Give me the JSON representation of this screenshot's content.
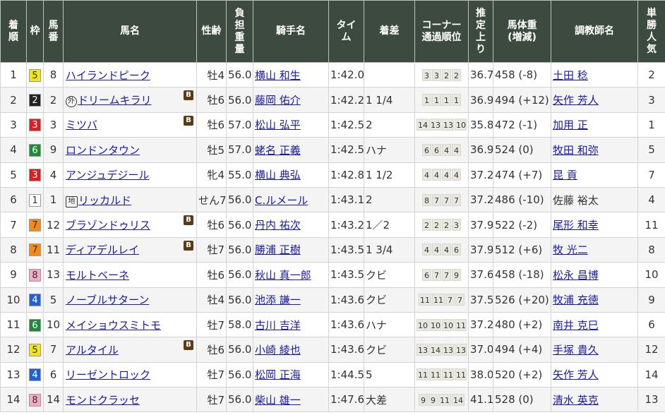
{
  "headers": {
    "rank": [
      "着",
      "順"
    ],
    "waku": "枠",
    "umaban": [
      "馬",
      "番"
    ],
    "horse": "馬名",
    "sexage": "性齢",
    "weight": [
      "負",
      "担",
      "重",
      "量"
    ],
    "jockey": "騎手名",
    "time": [
      "タイ",
      "ム"
    ],
    "margin": "着差",
    "corner": [
      "コーナー",
      "通過順位"
    ],
    "last3f": [
      "推",
      "定",
      "上",
      "り"
    ],
    "bodyweight": [
      "馬体重",
      "(増減)"
    ],
    "trainer": "調教師名",
    "pop": [
      "単",
      "勝",
      "人",
      "気"
    ]
  },
  "waku_colors": {
    "1": {
      "bg": "#ffffff",
      "fg": "#333333"
    },
    "2": {
      "bg": "#222222",
      "fg": "#ffffff"
    },
    "3": {
      "bg": "#d91f1f",
      "fg": "#ffffff"
    },
    "4": {
      "bg": "#1e62d0",
      "fg": "#ffffff"
    },
    "5": {
      "bg": "#f3e514",
      "fg": "#333333"
    },
    "6": {
      "bg": "#1f8a3a",
      "fg": "#ffffff"
    },
    "7": {
      "bg": "#f58a14",
      "fg": "#333333"
    },
    "8": {
      "bg": "#f7a8c4",
      "fg": "#333333"
    }
  },
  "rows": [
    {
      "rank": "1",
      "waku": "5",
      "umaban": "8",
      "mark": "",
      "horse": "ハイランドピーク",
      "blinker": false,
      "sexage": "牡4",
      "weight": "56.0",
      "jockey": "横山 和生",
      "time": "1:42.0",
      "margin": "",
      "corner": [
        "3",
        "3",
        "2",
        "2"
      ],
      "last3f": "36.7",
      "bodyweight": "458 (-8)",
      "trainer": "土田 稔",
      "trainer_link": true,
      "pop": "2"
    },
    {
      "rank": "2",
      "waku": "2",
      "umaban": "2",
      "mark": "外",
      "horse": "ドリームキラリ",
      "blinker": true,
      "sexage": "牡6",
      "weight": "56.0",
      "jockey": "藤岡 佑介",
      "time": "1:42.2",
      "margin": "1 1/4",
      "corner": [
        "1",
        "1",
        "1",
        "1"
      ],
      "last3f": "36.9",
      "bodyweight": "494 (+12)",
      "trainer": "矢作 芳人",
      "trainer_link": true,
      "pop": "3"
    },
    {
      "rank": "3",
      "waku": "3",
      "umaban": "3",
      "mark": "",
      "horse": "ミツバ",
      "blinker": true,
      "sexage": "牡6",
      "weight": "57.0",
      "jockey": "松山 弘平",
      "time": "1:42.5",
      "margin": "2",
      "corner": [
        "14",
        "13",
        "13",
        "10"
      ],
      "last3f": "35.8",
      "bodyweight": "472 (-1)",
      "trainer": "加用 正",
      "trainer_link": true,
      "pop": "1"
    },
    {
      "rank": "4",
      "waku": "6",
      "umaban": "9",
      "mark": "",
      "horse": "ロンドンタウン",
      "blinker": false,
      "sexage": "牡5",
      "weight": "57.0",
      "jockey": "蛯名 正義",
      "time": "1:42.5",
      "margin": "ハナ",
      "corner": [
        "6",
        "6",
        "4",
        "4"
      ],
      "last3f": "36.9",
      "bodyweight": "524 (0)",
      "trainer": "牧田 和弥",
      "trainer_link": true,
      "pop": "5"
    },
    {
      "rank": "5",
      "waku": "3",
      "umaban": "4",
      "mark": "",
      "horse": "アンジュデジール",
      "blinker": false,
      "sexage": "牝4",
      "weight": "55.0",
      "jockey": "横山 典弘",
      "time": "1:42.8",
      "margin": "1 1/2",
      "corner": [
        "4",
        "4",
        "4",
        "4"
      ],
      "last3f": "37.2",
      "bodyweight": "474 (+7)",
      "trainer": "昆 貢",
      "trainer_link": true,
      "pop": "7"
    },
    {
      "rank": "6",
      "waku": "1",
      "umaban": "1",
      "mark": "地",
      "horse": "リッカルド",
      "blinker": false,
      "sexage": "せん7",
      "weight": "56.0",
      "jockey": "C.ルメール",
      "time": "1:43.1",
      "margin": "2",
      "corner": [
        "8",
        "7",
        "7",
        "7"
      ],
      "last3f": "37.2",
      "bodyweight": "486 (-10)",
      "trainer": "佐藤 裕太",
      "trainer_link": false,
      "pop": "4"
    },
    {
      "rank": "7",
      "waku": "7",
      "umaban": "12",
      "mark": "",
      "horse": "ブラゾンドゥリス",
      "blinker": true,
      "sexage": "牡6",
      "weight": "56.0",
      "jockey": "丹内 祐次",
      "time": "1:43.2",
      "margin": "1／2",
      "corner": [
        "2",
        "2",
        "2",
        "3"
      ],
      "last3f": "37.9",
      "bodyweight": "522 (-2)",
      "trainer": "尾形 和幸",
      "trainer_link": true,
      "pop": "11"
    },
    {
      "rank": "8",
      "waku": "7",
      "umaban": "11",
      "mark": "",
      "horse": "ディアデルレイ",
      "blinker": true,
      "sexage": "牡7",
      "weight": "56.0",
      "jockey": "勝浦 正樹",
      "time": "1:43.5",
      "margin": "1 3/4",
      "corner": [
        "4",
        "4",
        "4",
        "6"
      ],
      "last3f": "37.9",
      "bodyweight": "512 (+6)",
      "trainer": "牧 光二",
      "trainer_link": true,
      "pop": "8"
    },
    {
      "rank": "9",
      "waku": "8",
      "umaban": "13",
      "mark": "",
      "horse": "モルトベーネ",
      "blinker": false,
      "sexage": "牡6",
      "weight": "56.0",
      "jockey": "秋山 真一郎",
      "time": "1:43.5",
      "margin": "クビ",
      "corner": [
        "6",
        "7",
        "7",
        "9"
      ],
      "last3f": "37.6",
      "bodyweight": "458 (-18)",
      "trainer": "松永 昌博",
      "trainer_link": true,
      "pop": "10"
    },
    {
      "rank": "10",
      "waku": "4",
      "umaban": "5",
      "mark": "",
      "horse": "ノーブルサターン",
      "blinker": false,
      "sexage": "牡4",
      "weight": "56.0",
      "jockey": "池添 謙一",
      "time": "1:43.6",
      "margin": "クビ",
      "corner": [
        "11",
        "11",
        "7",
        "7"
      ],
      "last3f": "37.5",
      "bodyweight": "526 (+20)",
      "trainer": "牧浦 充徳",
      "trainer_link": true,
      "pop": "9"
    },
    {
      "rank": "11",
      "waku": "6",
      "umaban": "10",
      "mark": "",
      "horse": "メイショウスミトモ",
      "blinker": false,
      "sexage": "牡7",
      "weight": "58.0",
      "jockey": "古川 吉洋",
      "time": "1:43.6",
      "margin": "ハナ",
      "corner": [
        "10",
        "10",
        "10",
        "11"
      ],
      "last3f": "37.2",
      "bodyweight": "480 (+2)",
      "trainer": "南井 克巳",
      "trainer_link": true,
      "pop": "6"
    },
    {
      "rank": "12",
      "waku": "5",
      "umaban": "7",
      "mark": "",
      "horse": "アルタイル",
      "blinker": true,
      "sexage": "牡6",
      "weight": "56.0",
      "jockey": "小崎 綾也",
      "time": "1:43.6",
      "margin": "クビ",
      "corner": [
        "13",
        "14",
        "13",
        "13"
      ],
      "last3f": "37.0",
      "bodyweight": "494 (+4)",
      "trainer": "手塚 貴久",
      "trainer_link": true,
      "pop": "12"
    },
    {
      "rank": "13",
      "waku": "4",
      "umaban": "6",
      "mark": "",
      "horse": "リーゼントロック",
      "blinker": false,
      "sexage": "牡7",
      "weight": "56.0",
      "jockey": "松岡 正海",
      "time": "1:44.5",
      "margin": "5",
      "corner": [
        "11",
        "11",
        "11",
        "11"
      ],
      "last3f": "38.0",
      "bodyweight": "520 (+2)",
      "trainer": "矢作 芳人",
      "trainer_link": true,
      "pop": "14"
    },
    {
      "rank": "14",
      "waku": "8",
      "umaban": "14",
      "mark": "",
      "horse": "モンドクラッセ",
      "blinker": false,
      "sexage": "牡7",
      "weight": "56.0",
      "jockey": "柴山 雄一",
      "time": "1:47.6",
      "margin": "大差",
      "corner": [
        "9",
        "9",
        "11",
        "14"
      ],
      "last3f": "41.1",
      "bodyweight": "528 (0)",
      "trainer": "清水 英克",
      "trainer_link": true,
      "pop": "13"
    }
  ]
}
